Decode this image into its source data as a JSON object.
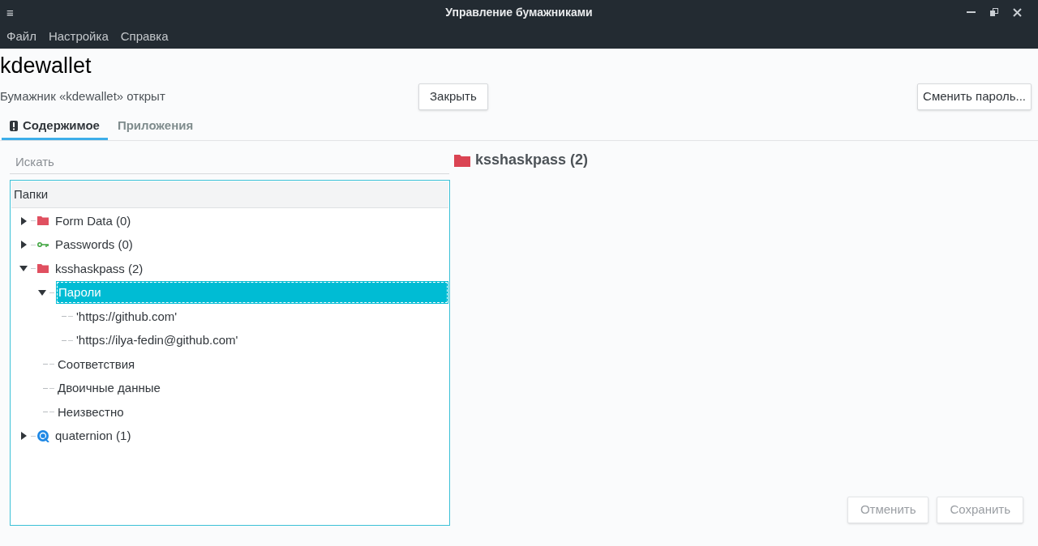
{
  "window": {
    "title": "Управление бумажниками",
    "menu_icon": "≡"
  },
  "menubar": [
    "Файл",
    "Настройка",
    "Справка"
  ],
  "wallet": {
    "name": "kdewallet",
    "status": "Бумажник «kdewallet» открыт",
    "close_button": "Закрыть",
    "change_password_button": "Сменить пароль..."
  },
  "tabs": [
    {
      "label": "Содержимое",
      "selected": true
    },
    {
      "label": "Приложения",
      "selected": false
    }
  ],
  "search": {
    "placeholder": "Искать"
  },
  "tree": {
    "header": "Папки",
    "items": [
      {
        "label": "Form Data (0)",
        "kind": "folder",
        "expanded": false,
        "selected": false
      },
      {
        "label": "Passwords (0)",
        "kind": "key",
        "expanded": false,
        "selected": false
      },
      {
        "label": "ksshaskpass (2)",
        "kind": "folder",
        "expanded": true,
        "selected": false,
        "children": [
          {
            "label": "Пароли",
            "expanded": true,
            "selected": true,
            "children": [
              {
                "label": "'https://github.com'",
                "selected": false
              },
              {
                "label": "'https://ilya-fedin@github.com'",
                "selected": false
              }
            ]
          },
          {
            "label": "Соответствия",
            "selected": false
          },
          {
            "label": "Двоичные данные",
            "selected": false
          },
          {
            "label": "Неизвестно",
            "selected": false
          }
        ]
      },
      {
        "label": "quaternion (1)",
        "kind": "app",
        "expanded": false,
        "selected": false
      }
    ]
  },
  "detail": {
    "title": "ksshaskpass (2)"
  },
  "buttons": [
    {
      "label": "Отменить",
      "disabled": true
    },
    {
      "label": "Сохранить",
      "disabled": true
    }
  ]
}
